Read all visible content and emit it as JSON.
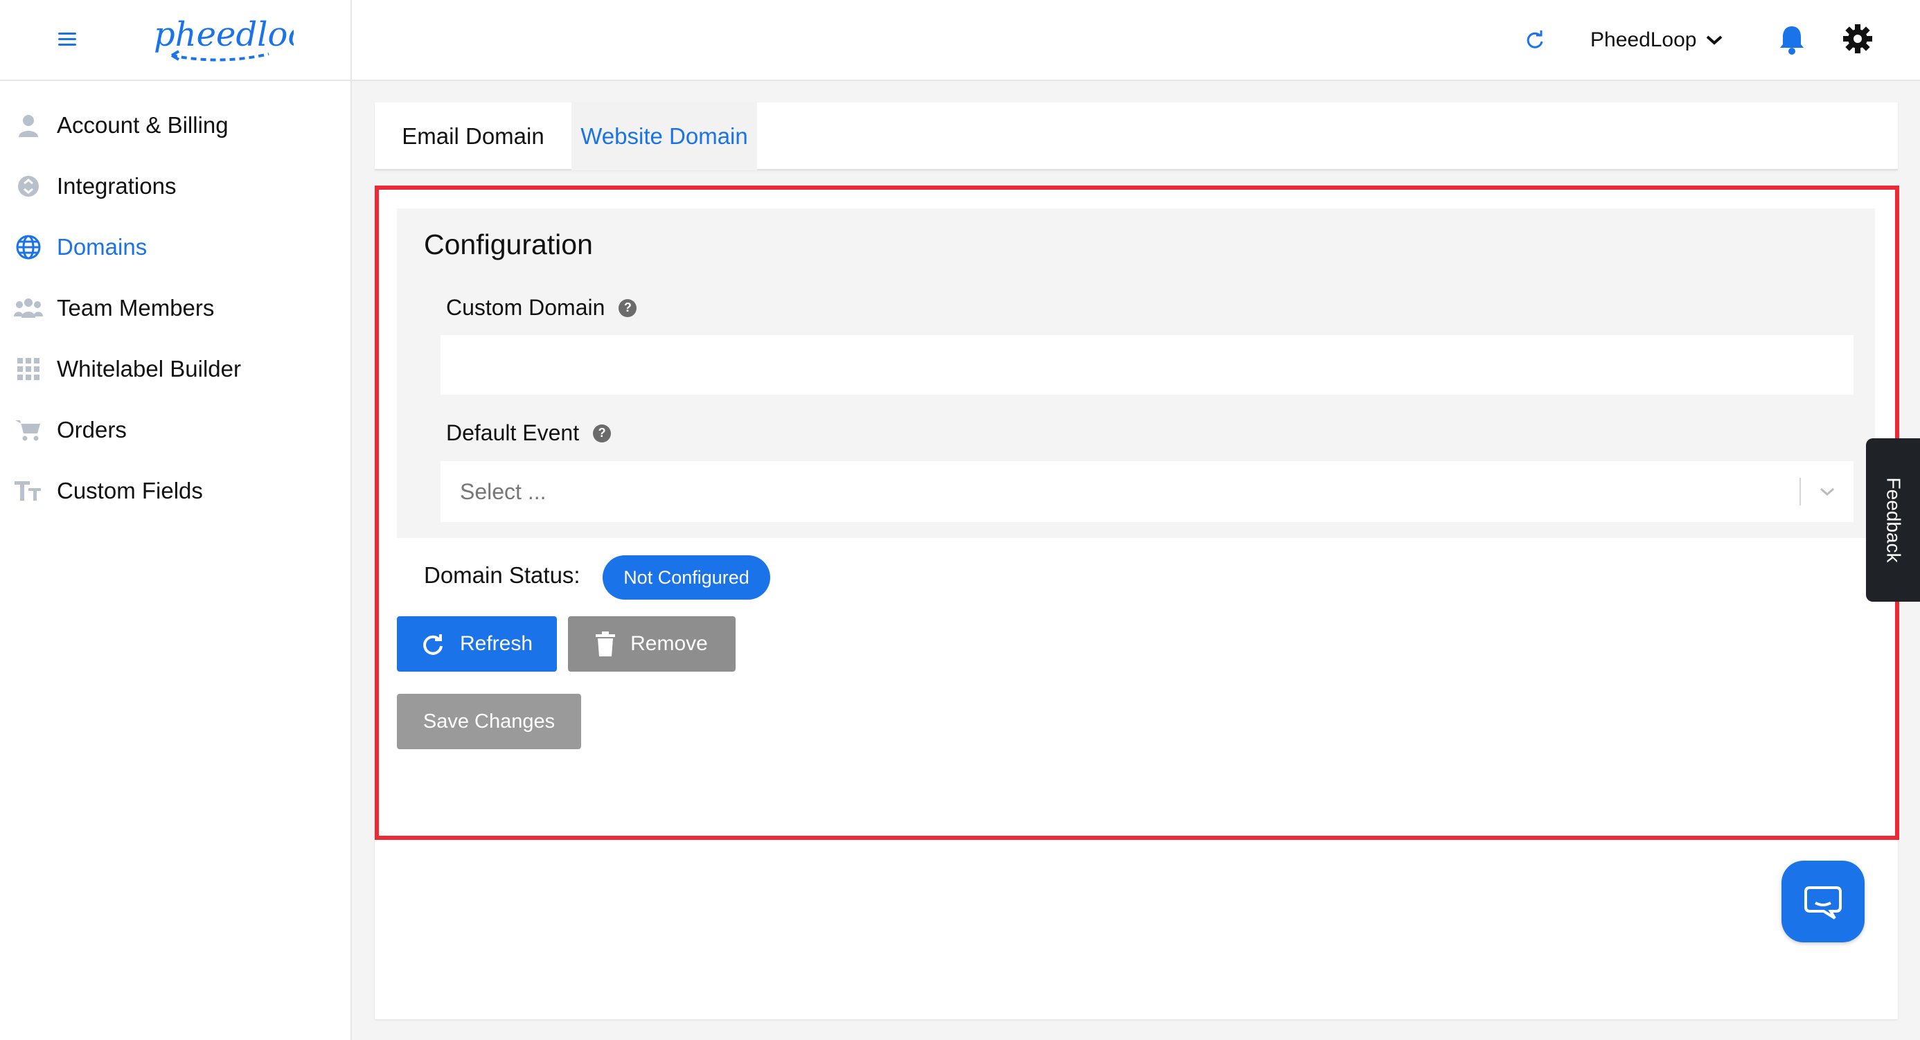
{
  "header": {
    "logo_text": "pheedloop",
    "org_name": "PheedLoop"
  },
  "sidebar": {
    "items": [
      {
        "label": "Account & Billing",
        "icon": "user-icon"
      },
      {
        "label": "Integrations",
        "icon": "integrations-icon"
      },
      {
        "label": "Domains",
        "icon": "globe-icon",
        "active": true
      },
      {
        "label": "Team Members",
        "icon": "team-icon"
      },
      {
        "label": "Whitelabel Builder",
        "icon": "grid-icon"
      },
      {
        "label": "Orders",
        "icon": "cart-icon"
      },
      {
        "label": "Custom Fields",
        "icon": "text-icon"
      }
    ]
  },
  "tabs": [
    {
      "label": "Email Domain",
      "active": false
    },
    {
      "label": "Website Domain",
      "active": true
    }
  ],
  "config": {
    "title": "Configuration",
    "custom_domain_label": "Custom Domain",
    "custom_domain_value": "",
    "default_event_label": "Default Event",
    "default_event_placeholder": "Select ..."
  },
  "status": {
    "label": "Domain Status:",
    "value": "Not Configured"
  },
  "buttons": {
    "refresh": "Refresh",
    "remove": "Remove",
    "save": "Save Changes"
  },
  "feedback": "Feedback",
  "colors": {
    "accent": "#1a73e8",
    "highlight": "#ec2a35",
    "disabled": "#9a9a9a"
  }
}
